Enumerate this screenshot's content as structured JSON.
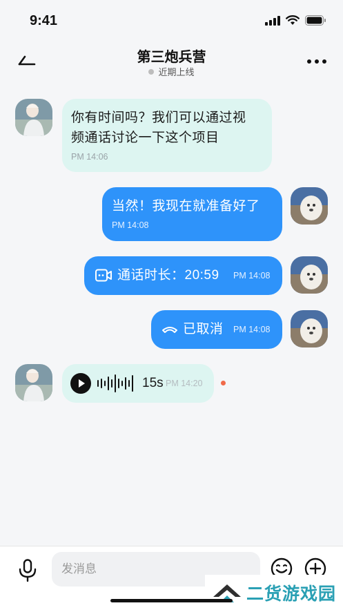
{
  "status_bar": {
    "time": "9:41"
  },
  "header": {
    "title": "第三炮兵营",
    "status": "近期上线"
  },
  "messages": [
    {
      "from": "them",
      "text_line1": "你有时间吗？我们可以通过视",
      "text_line2": "频通话讨论一下这个项目",
      "time": "PM 14:06"
    },
    {
      "from": "me",
      "text": "当然！我现在就准备好了",
      "time": "PM 14:08"
    },
    {
      "from": "me",
      "type": "video-call",
      "text": "通话时长：20:59",
      "time": "PM 14:08"
    },
    {
      "from": "me",
      "type": "call-cancelled",
      "text": "已取消",
      "time": "PM 14:08"
    },
    {
      "from": "them",
      "type": "voice",
      "duration": "15s",
      "time": "PM 14:20",
      "unread": true
    }
  ],
  "input_bar": {
    "placeholder": "发消息"
  },
  "watermark": {
    "text": "二货游戏园"
  },
  "colors": {
    "outgoing_bubble": "#2e93fa",
    "incoming_bubble": "#ddf5f1",
    "unread_dot": "#f06a4a",
    "watermark": "#2aa0b4"
  }
}
